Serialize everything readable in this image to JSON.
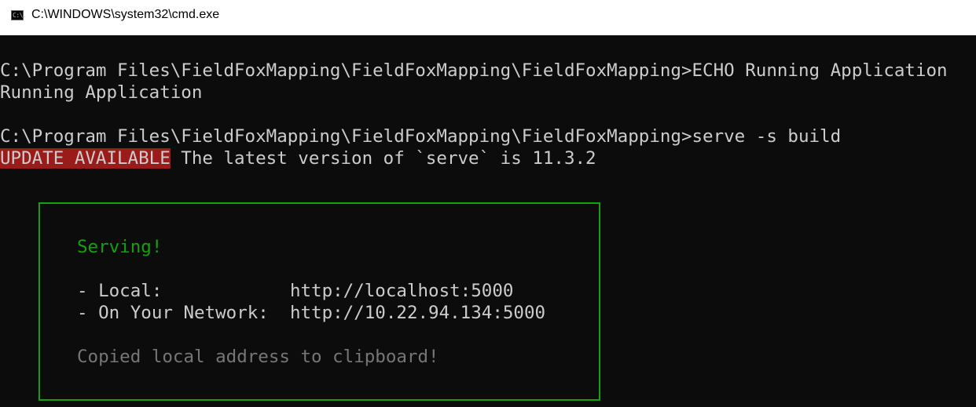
{
  "window": {
    "title": "C:\\WINDOWS\\system32\\cmd.exe",
    "icon_name": "cmd-icon",
    "icon_glyph": "C:\\."
  },
  "console": {
    "lines": [
      "C:\\Program Files\\FieldFoxMapping\\FieldFoxMapping\\FieldFoxMapping>ECHO Running Application",
      "Running Application",
      "C:\\Program Files\\FieldFoxMapping\\FieldFoxMapping\\FieldFoxMapping>serve -s build"
    ],
    "update": {
      "badge": "UPDATE AVAILABLE",
      "message": " The latest version of `serve` is 11.3.2"
    },
    "box": {
      "heading": "Serving!",
      "local_label": "- Local:            ",
      "local_url": "http://localhost:5000",
      "network_label": "- On Your Network:  ",
      "network_url": "http://10.22.94.134:5000",
      "footer": "Copied local address to clipboard!"
    }
  },
  "colors": {
    "background": "#0c0c0c",
    "text": "#cccccc",
    "badge_bg": "#9b1b1b",
    "box_border": "#13a10e",
    "heading": "#13a10e",
    "footer": "#767676"
  }
}
